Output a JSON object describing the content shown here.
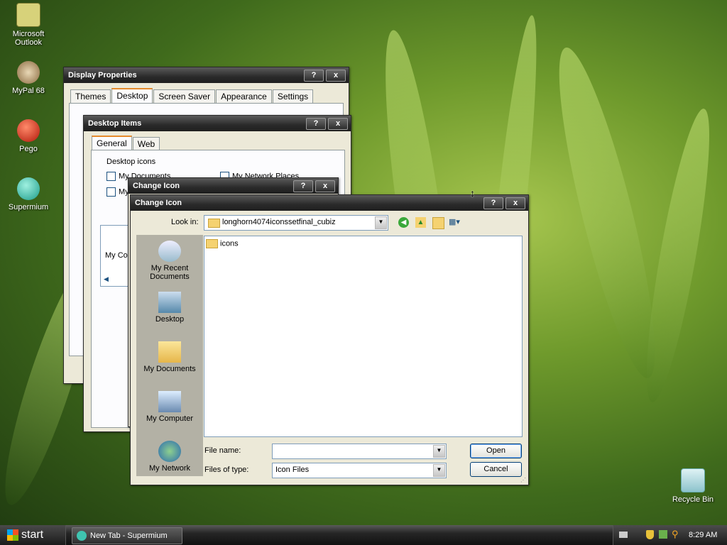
{
  "desktop": {
    "icons": [
      {
        "label": "Microsoft\nOutlook"
      },
      {
        "label": "MyPal 68"
      },
      {
        "label": "Pego"
      },
      {
        "label": "Supermium"
      },
      {
        "label": "Recycle Bin"
      }
    ]
  },
  "display_properties": {
    "title": "Display Properties",
    "help": "?",
    "close": "x",
    "tabs": [
      "Themes",
      "Desktop",
      "Screen Saver",
      "Appearance",
      "Settings"
    ],
    "active_tab": "Desktop"
  },
  "desktop_items": {
    "title": "Desktop Items",
    "help": "?",
    "close": "x",
    "tabs": [
      "General",
      "Web"
    ],
    "group_label": "Desktop icons",
    "checkboxes": [
      "My Documents",
      "My Network Places",
      "My",
      "My"
    ],
    "preview_label": "My Co"
  },
  "change_icon_back": {
    "title": "Change Icon"
  },
  "change_icon": {
    "title": "Change Icon",
    "help": "?",
    "close": "x",
    "look_in_label": "Look in:",
    "look_in_value": "longhorn4074iconssetfinal_cubiz",
    "places": [
      "My Recent\nDocuments",
      "Desktop",
      "My Documents",
      "My Computer",
      "My Network"
    ],
    "files": [
      "icons"
    ],
    "file_name_label": "File name:",
    "file_name_value": "",
    "file_type_label": "Files of type:",
    "file_type_value": "Icon Files",
    "open_label": "Open",
    "cancel_label": "Cancel"
  },
  "taskbar": {
    "start_label": "start",
    "task_label": "New Tab - Supermium",
    "clock": "8:29 AM"
  },
  "colors": {
    "title_dark": "#2a2a2a",
    "tab_accent": "#e68b2c"
  }
}
